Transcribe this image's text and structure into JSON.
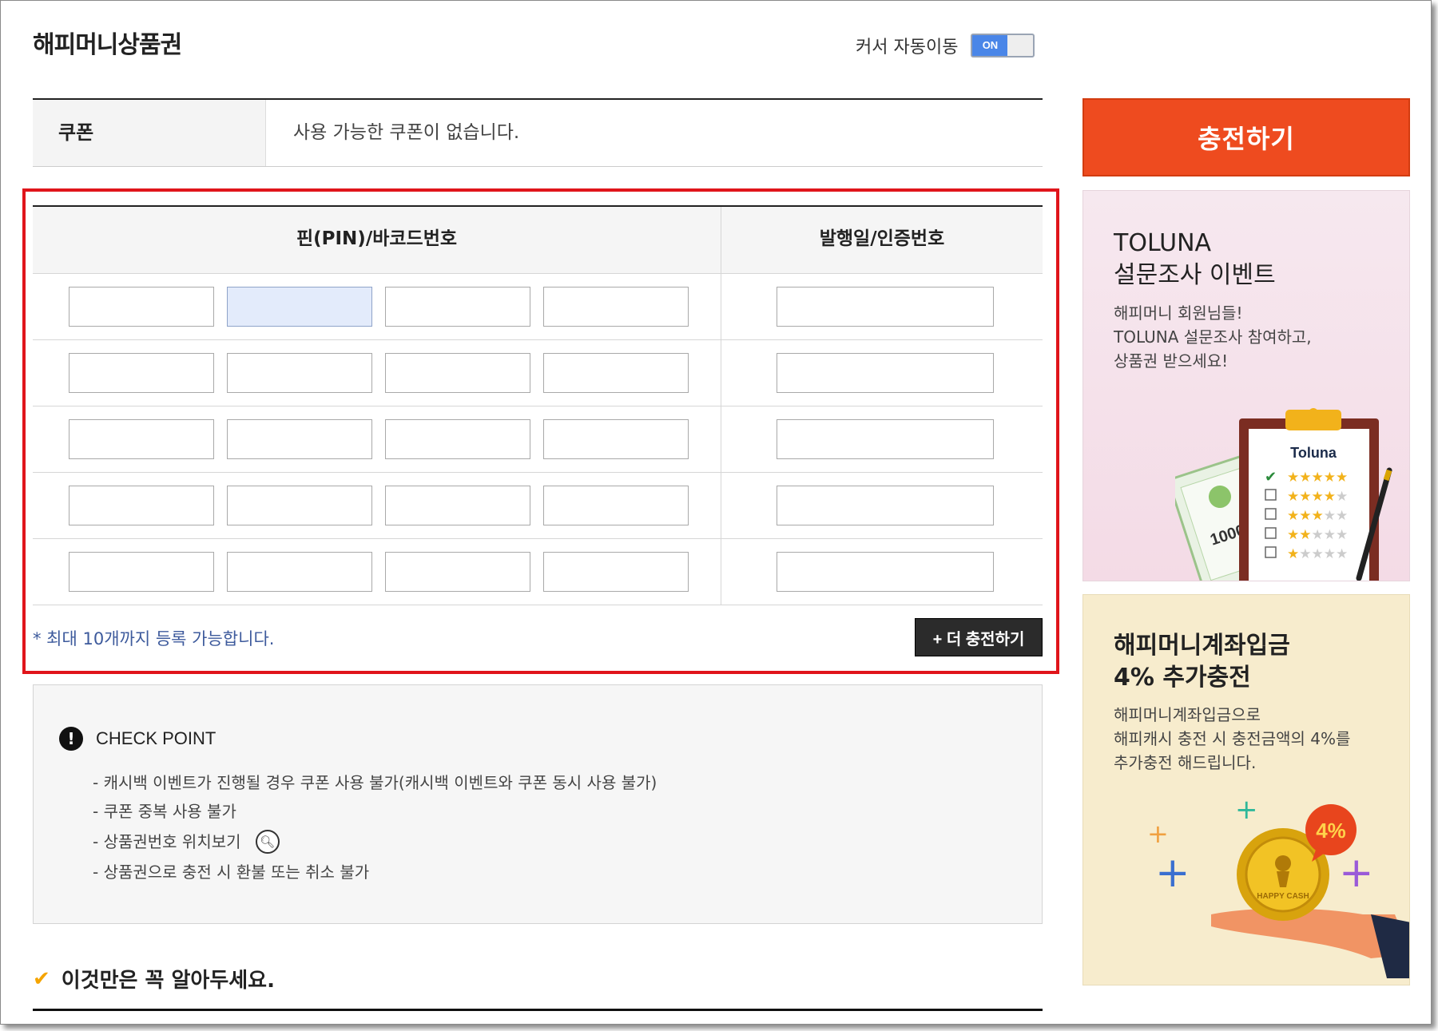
{
  "header": {
    "title": "해피머니상품권",
    "auto_cursor_label": "커서 자동이동",
    "auto_cursor_state": "ON"
  },
  "coupon": {
    "label": "쿠폰",
    "value": "사용 가능한 쿠폰이 없습니다."
  },
  "pin_table": {
    "header_pin": "핀(PIN)/바코드번호",
    "header_date": "발행일/인증번호",
    "row_count": 5,
    "note": "* 최대 10개까지 등록 가능합니다.",
    "more_button": "+ 더 충전하기"
  },
  "checkpoint": {
    "title": "CHECK POINT",
    "items": [
      "- 캐시백 이벤트가 진행될 경우 쿠폰 사용 불가(캐시백 이벤트와 쿠폰 동시 사용 불가)",
      "- 쿠폰 중복 사용 불가",
      "- 상품권번호 위치보기",
      "- 상품권으로 충전 시 환불 또는 취소 불가"
    ]
  },
  "know": {
    "title": "이것만은 꼭 알아두세요."
  },
  "sidebar": {
    "charge_button": "충전하기",
    "banner1": {
      "title_line1": "TOLUNA",
      "title_line2": "설문조사 이벤트",
      "desc_line1": "해피머니 회원님들!",
      "desc_line2": "TOLUNA 설문조사 참여하고,",
      "desc_line3": "상품권 받으세요!",
      "logo_text": "Toluna",
      "ticket_text": "10000"
    },
    "banner2": {
      "title_line1": "해피머니계좌입금",
      "title_line2": "4% 추가충전",
      "desc_line1": "해피머니계좌입금으로",
      "desc_line2": "해피캐시 충전 시 충전금액의 4%를",
      "desc_line3": "추가충전 해드립니다.",
      "badge": "4%",
      "coin_text": "HAPPY CASH"
    }
  },
  "colors": {
    "accent_red": "#ee4b1f",
    "highlight_border": "#e0151b",
    "toggle_blue": "#4a86e8",
    "note_blue": "#3d5a9c"
  }
}
